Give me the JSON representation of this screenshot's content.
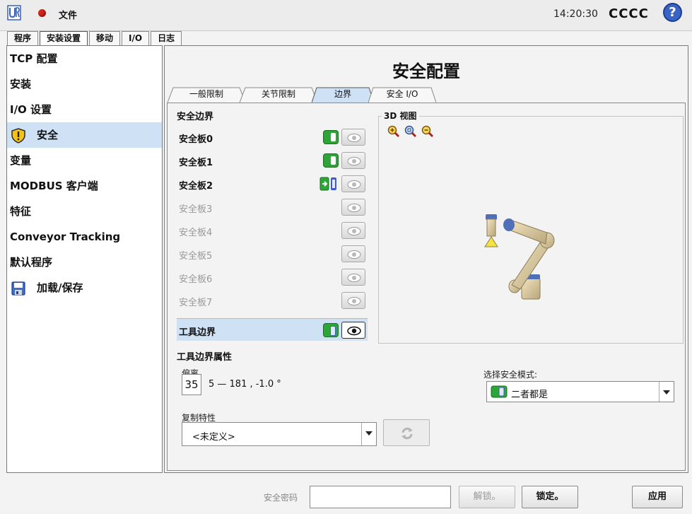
{
  "topbar": {
    "file_label": "文件",
    "time": "14:20:30",
    "robot_name": "CCCC",
    "help_label": "?"
  },
  "main_tabs": [
    {
      "label": "程序",
      "active": false
    },
    {
      "label": "安装设置",
      "active": true
    },
    {
      "label": "移动",
      "active": false
    },
    {
      "label": "I/O",
      "active": false
    },
    {
      "label": "日志",
      "active": false
    }
  ],
  "sidebar": {
    "items": [
      {
        "label": "TCP 配置"
      },
      {
        "label": "安装"
      },
      {
        "label": "I/O 设置"
      },
      {
        "label": "安全",
        "selected": true,
        "icon": "warning-shield-icon"
      },
      {
        "label": "变量"
      },
      {
        "label": "MODBUS 客户端"
      },
      {
        "label": "特征"
      },
      {
        "label": "Conveyor Tracking"
      },
      {
        "label": "默认程序"
      },
      {
        "label": "加载/保存",
        "icon": "floppy-disk-icon"
      }
    ]
  },
  "page": {
    "title": "安全配置",
    "subtabs": [
      "一般限制",
      "关节限制",
      "边界",
      "安全 I/O"
    ],
    "active_subtab": "边界"
  },
  "boundaries": {
    "section_title": "安全边界",
    "planes": [
      {
        "label": "安全板0",
        "state": "enabled"
      },
      {
        "label": "安全板1",
        "state": "enabled"
      },
      {
        "label": "安全板2",
        "state": "trigger"
      },
      {
        "label": "安全板3",
        "state": "disabled"
      },
      {
        "label": "安全板4",
        "state": "disabled"
      },
      {
        "label": "安全板5",
        "state": "disabled"
      },
      {
        "label": "安全板6",
        "state": "disabled"
      },
      {
        "label": "安全板7",
        "state": "disabled"
      }
    ],
    "tool_boundary": {
      "label": "工具边界",
      "state": "both",
      "visible": true
    }
  },
  "view3d": {
    "title": "3D 视图",
    "icons": [
      "zoom-in-icon",
      "zoom-fit-icon",
      "zoom-out-icon"
    ]
  },
  "tool_props": {
    "title": "工具边界属性",
    "offset_label": "偏离",
    "offset_value": "35",
    "offset_text": "5 — 181 , -1.0 °",
    "copy_label": "复制特性",
    "copy_value": "<未定义>",
    "mode_label": "选择安全模式:",
    "mode_value": "二者都是"
  },
  "bottom": {
    "password_label": "安全密码",
    "password_value": "",
    "unlock_label": "解锁。",
    "lock_label": "锁定。",
    "apply_label": "应用"
  },
  "colors": {
    "accent_green": "#2ea537",
    "selection_blue": "#cfe1f5",
    "status_red": "#d9241c",
    "help_blue": "#3a63c6"
  }
}
